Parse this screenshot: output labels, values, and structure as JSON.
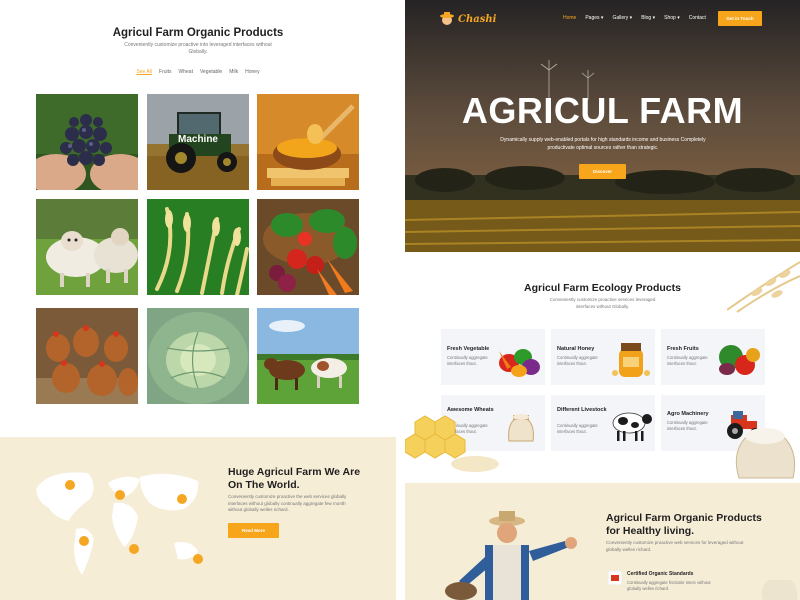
{
  "left": {
    "title": "Agricul Farm Organic Products",
    "subtitle": "Conveniently customize proactive into leveraged interfaces without Globally.",
    "filters": [
      "See All",
      "Fruits",
      "Wheat",
      "Vegetable",
      "Milk",
      "Honey"
    ],
    "active_filter": "See All",
    "gallery": [
      {
        "icon": "grapes-photo"
      },
      {
        "icon": "tractor-photo",
        "label": "Machine"
      },
      {
        "icon": "honey-photo"
      },
      {
        "icon": "sheep-photo"
      },
      {
        "icon": "wheat-photo"
      },
      {
        "icon": "vegetables-photo"
      },
      {
        "icon": "chickens-photo"
      },
      {
        "icon": "cabbage-photo"
      },
      {
        "icon": "cows-photo"
      }
    ],
    "world_section": {
      "title": "Huge Agricul Farm We Are On The World.",
      "text": "Conveniently customize proactive the web services globally interfaces without globally continually aggregate few month without globally welles richard.",
      "button": "Read More"
    }
  },
  "right": {
    "nav": {
      "logo": "Chashi",
      "menu": [
        "Home",
        "Pages",
        "Gallery",
        "Blog",
        "Shop",
        "Contact"
      ],
      "current": "Home",
      "button": "Get in Touch"
    },
    "hero": {
      "title": "AGRICUL FARM",
      "subtitle": "Dynamically supply web-enabled portals for high standards income and business Completely productivate optimal sources rather than strategic.",
      "button": "Discover"
    },
    "ecology": {
      "title": "Agricul Farm Ecology Products",
      "subtitle": "Conveniently customize proactive services leveraged interfaces without Globally.",
      "cards": [
        {
          "title": "Fresh Vegetable",
          "text": "Continually aggregate interfaces thout.",
          "icon": "vegetables-icon"
        },
        {
          "title": "Natural Honey",
          "text": "Continually aggregate interfaces thout.",
          "icon": "honey-jar-icon"
        },
        {
          "title": "Fresh Fruits",
          "text": "Continually aggregate interfaces thout.",
          "icon": "fruits-icon"
        },
        {
          "title": "Awesome Wheats",
          "text": "Continually aggregate interfaces thout.",
          "icon": "wheat-sack-icon"
        },
        {
          "title": "Different Livestock",
          "text": "Continually aggregate interfaces thout.",
          "icon": "cow-icon"
        },
        {
          "title": "Agro Machinery",
          "text": "Continually aggregate interfaces thout.",
          "icon": "tractor-icon"
        }
      ]
    },
    "healthy_section": {
      "title": "Agricul Farm Organic Products for Healthy living.",
      "text": "Conveniently customize proactive web services for leveraged without globally welles richard.",
      "feature_title": "Certified Organic Standards",
      "feature_text": "Continually aggregate frictionle Interc without globally welles richard."
    }
  },
  "colors": {
    "accent": "#f7a51b",
    "cream": "#f6edd7",
    "card_bg": "#f3f5f8",
    "heading": "#1f1f1f",
    "body_text": "#777777"
  }
}
